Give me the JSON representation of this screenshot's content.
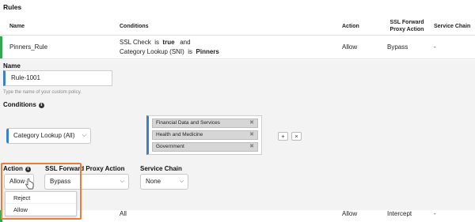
{
  "title": "Rules",
  "columns": [
    "Name",
    "Conditions",
    "Action",
    "SSL Forward Proxy Action",
    "Service Chain"
  ],
  "rows": [
    {
      "name": "Pinners_Rule",
      "conditions_line1": [
        "SSL Check",
        "is",
        "true",
        "and"
      ],
      "conditions_line2": [
        "Category Lookup (SNI)",
        "is",
        "Pinners"
      ],
      "action": "Allow",
      "ssl_action": "Bypass",
      "service_chain": "-"
    },
    {
      "name": "",
      "conditions": "All",
      "action": "Allow",
      "ssl_action": "Intercept",
      "service_chain": "-"
    }
  ],
  "editor": {
    "name_label": "Name",
    "name_value": "Rule-1001",
    "name_hint": "Type the name of your custom policy.",
    "conditions_label": "Conditions",
    "condition_select": "Category Lookup (All)",
    "condition_tags": [
      "Financial Data and Services",
      "Health and Medicine",
      "Government"
    ],
    "add_symbol": "+",
    "remove_symbol": "×",
    "action_label": "Action",
    "action_value": "Allow",
    "action_options": [
      "Reject",
      "Allow"
    ],
    "ssl_label": "SSL Forward Proxy Action",
    "ssl_value": "Bypass",
    "chain_label": "Service Chain",
    "chain_value": "None"
  },
  "colors": {
    "accent": "#3b82c4",
    "highlight": "#ef7b3a",
    "status_green": "#2fa84f"
  }
}
